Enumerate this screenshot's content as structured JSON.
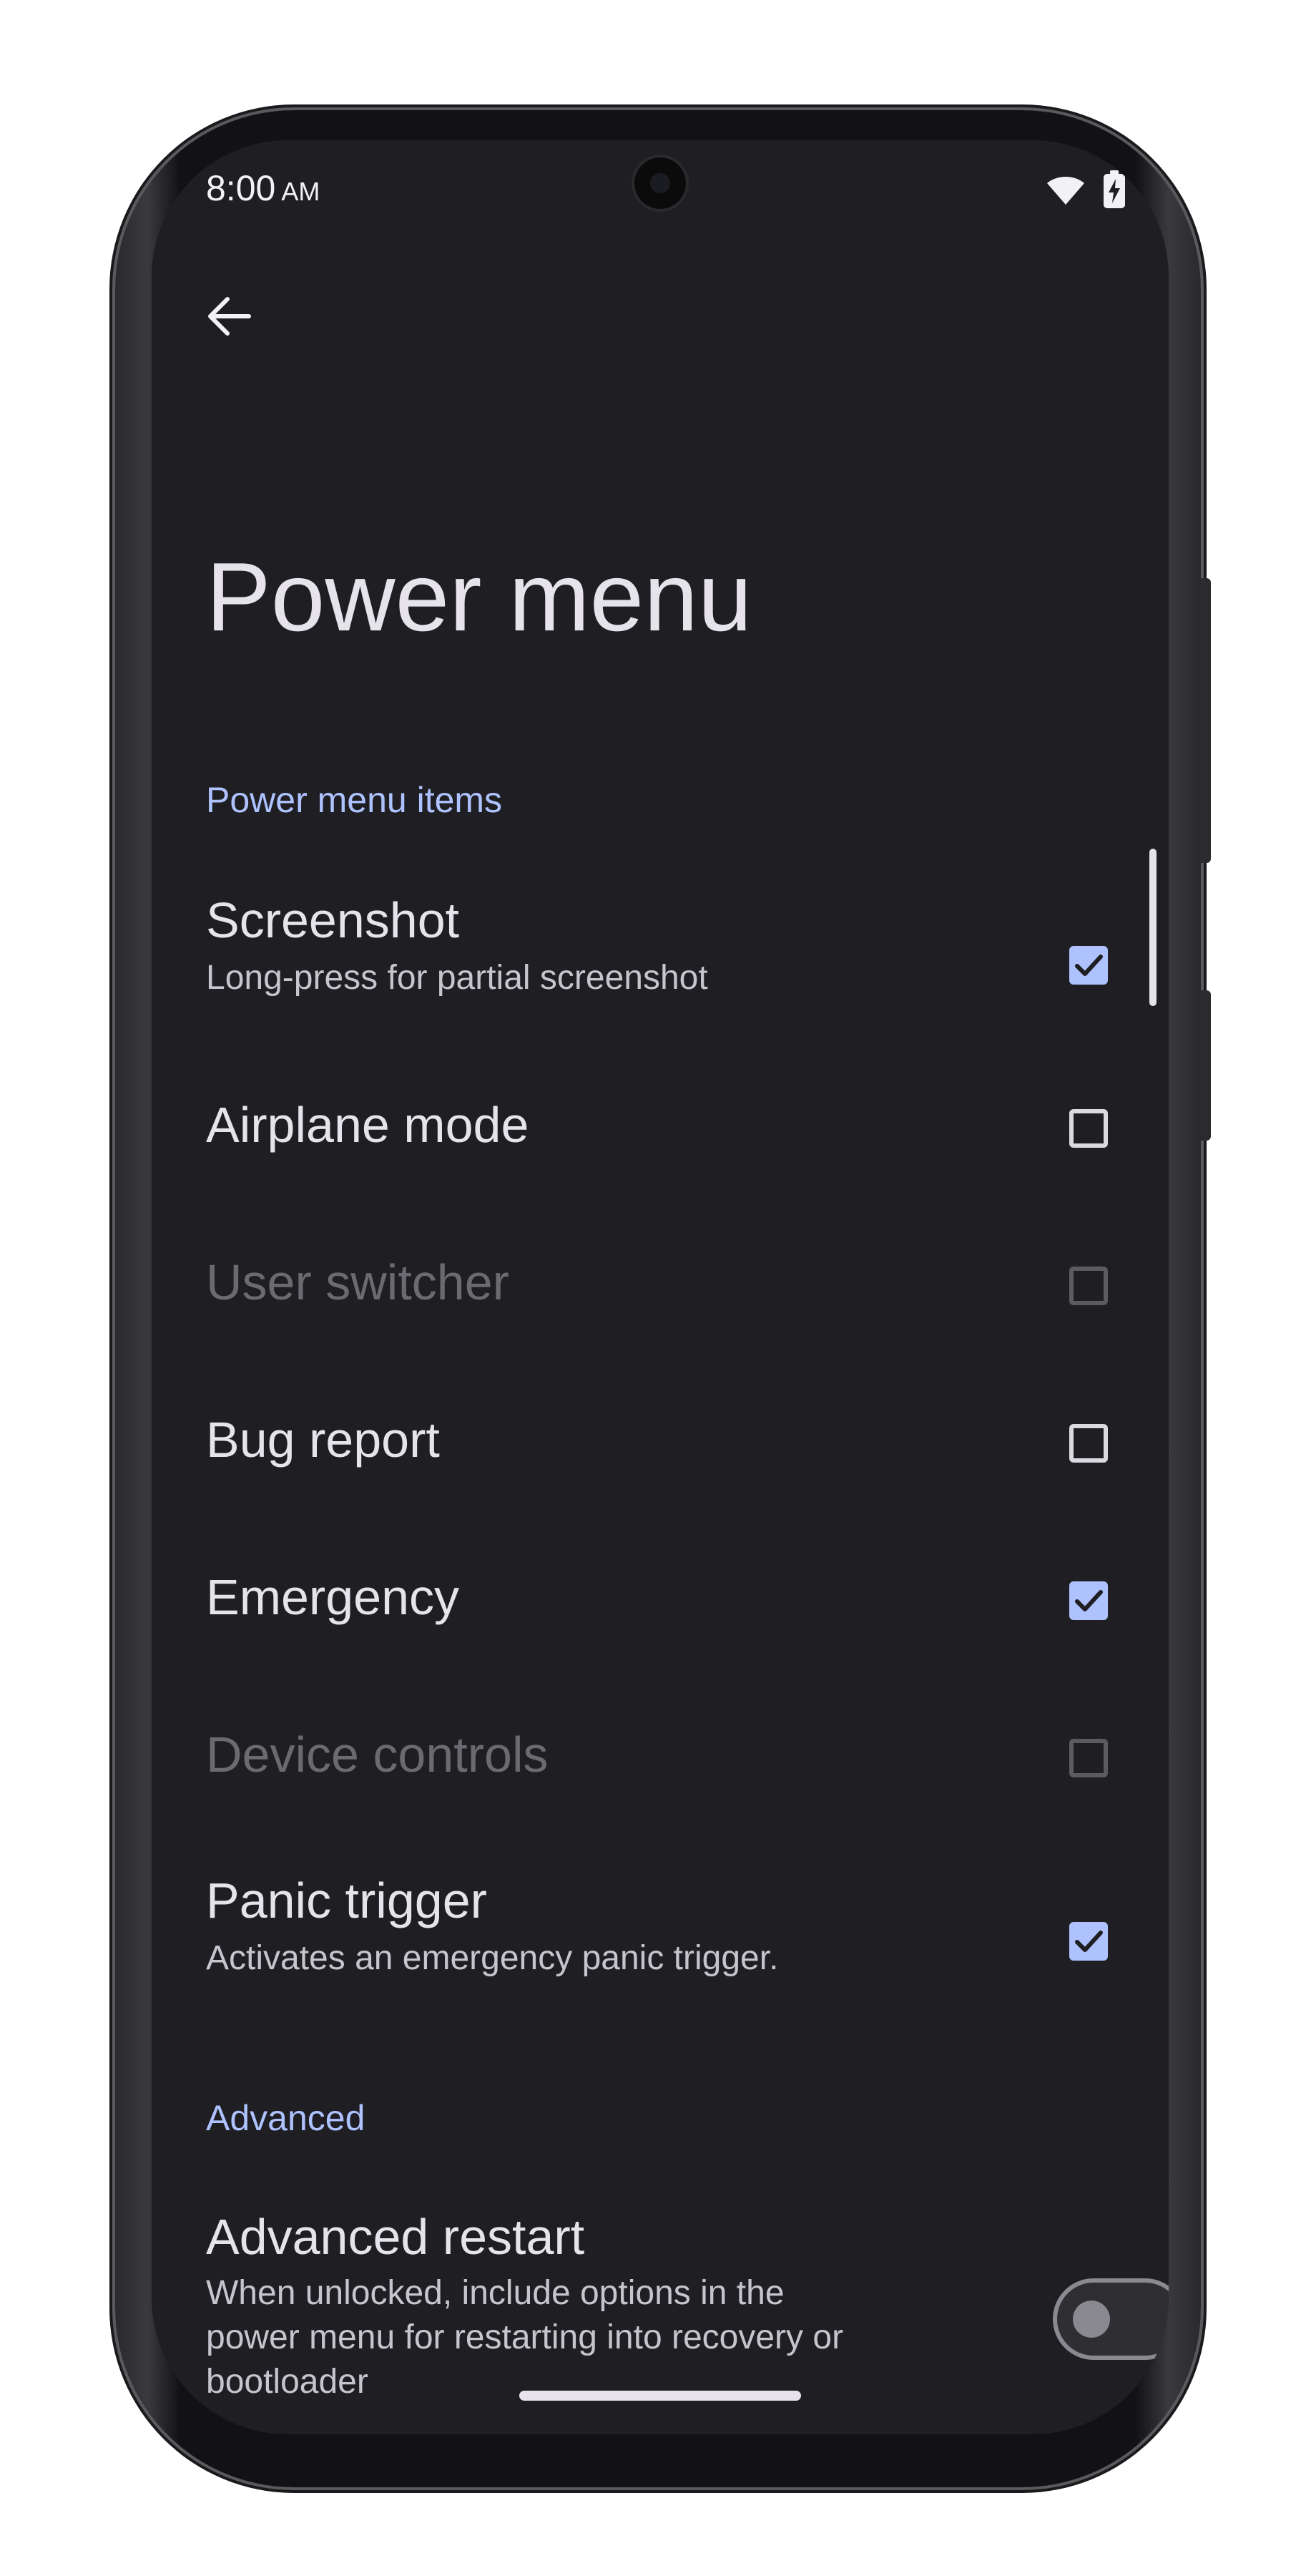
{
  "status_bar": {
    "time": "8:00",
    "ampm": "AM",
    "icons": [
      "wifi-icon",
      "battery-charging-icon"
    ]
  },
  "toolbar": {
    "back_icon": "arrow-left-icon"
  },
  "page": {
    "title": "Power menu"
  },
  "sections": {
    "items_header": "Power menu items",
    "advanced_header": "Advanced"
  },
  "items": {
    "screenshot": {
      "title": "Screenshot",
      "summary": "Long-press for partial screenshot",
      "checked": true,
      "enabled": true
    },
    "airplane": {
      "title": "Airplane mode",
      "checked": false,
      "enabled": true
    },
    "user_switcher": {
      "title": "User switcher",
      "checked": false,
      "enabled": false
    },
    "bug_report": {
      "title": "Bug report",
      "checked": false,
      "enabled": true
    },
    "emergency": {
      "title": "Emergency",
      "checked": true,
      "enabled": true
    },
    "device_controls": {
      "title": "Device controls",
      "checked": false,
      "enabled": false
    },
    "panic_trigger": {
      "title": "Panic trigger",
      "summary": "Activates an emergency panic trigger.",
      "checked": true,
      "enabled": true
    }
  },
  "advanced": {
    "restart": {
      "title": "Advanced restart",
      "summary_line1": "When unlocked, include options in the",
      "summary_line2": "power menu for restarting into recovery or",
      "summary_line3": "bootloader",
      "toggle_on": false
    }
  },
  "colors": {
    "accent": "#aec2ff",
    "background": "#1f1f23",
    "text_primary": "#e6e4ea",
    "text_disabled": "#6b6a70"
  }
}
